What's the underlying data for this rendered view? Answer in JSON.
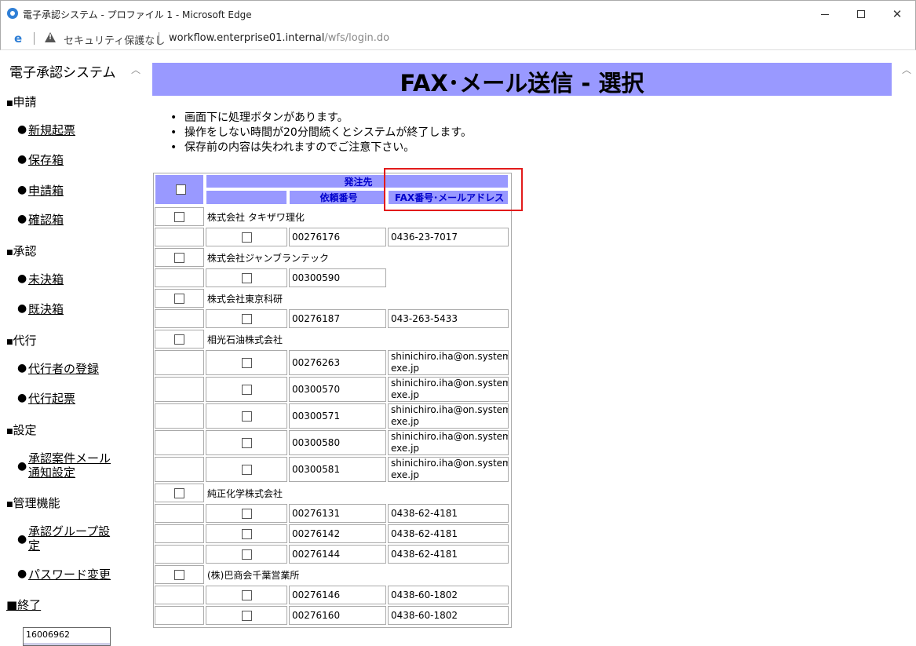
{
  "window": {
    "title": "電子承認システム - プロファイル 1 - Microsoft Edge"
  },
  "address": {
    "security_text": "セキュリティ保護なし",
    "url_host": "workflow.enterprise01.internal",
    "url_path": "/wfs/login.do"
  },
  "sidebar": {
    "title": "電子承認システム",
    "sections": {
      "apply": "申請",
      "approve": "承認",
      "proxy": "代行",
      "settings": "設定",
      "admin": "管理機能"
    },
    "items": {
      "new": "新規起票",
      "saved": "保存箱",
      "applied": "申請箱",
      "confirm": "確認箱",
      "pending": "未決箱",
      "decided": "既決箱",
      "proxy_reg": "代行者の登録",
      "proxy_issue": "代行起票",
      "notify_line1": "承認案件メール",
      "notify_line2": "通知設定",
      "group_line1": "承認グループ設",
      "group_line2": "定",
      "password": "パスワード変更"
    },
    "end_label": "■終了",
    "user_id": "16006962"
  },
  "page": {
    "heading": "FAX･メール送信 - 選択",
    "notes": [
      "画面下に処理ボタンがあります。",
      "操作をしない時間が20分間続くとシステムが終了します。",
      "保存前の内容は失われますのでご注意下さい。"
    ]
  },
  "table": {
    "header_group": "発注先",
    "col_request": "依頼番号",
    "col_fax": "FAX番号･メールアドレス",
    "companies": [
      {
        "name": "株式会社 タキザワ理化",
        "rows": [
          {
            "req": "00276176",
            "fax": "0436-23-7017"
          }
        ]
      },
      {
        "name": "株式会社ジャンブランテック",
        "rows": [
          {
            "req": "00300590",
            "fax": ""
          }
        ]
      },
      {
        "name": "株式会社東京科研",
        "rows": [
          {
            "req": "00276187",
            "fax": "043-263-5433"
          }
        ]
      },
      {
        "name": "相光石油株式会社",
        "rows": [
          {
            "req": "00276263",
            "fax_1": "shinichiro.iha@on.system-",
            "fax_2": "exe.jp"
          },
          {
            "req": "00300570",
            "fax_1": "shinichiro.iha@on.system-",
            "fax_2": "exe.jp"
          },
          {
            "req": "00300571",
            "fax_1": "shinichiro.iha@on.system-",
            "fax_2": "exe.jp"
          },
          {
            "req": "00300580",
            "fax_1": "shinichiro.iha@on.system-",
            "fax_2": "exe.jp"
          },
          {
            "req": "00300581",
            "fax_1": "shinichiro.iha@on.system-",
            "fax_2": "exe.jp"
          }
        ]
      },
      {
        "name": "純正化学株式会社",
        "rows": [
          {
            "req": "00276131",
            "fax": "0438-62-4181"
          },
          {
            "req": "00276142",
            "fax": "0438-62-4181"
          },
          {
            "req": "00276144",
            "fax": "0438-62-4181"
          }
        ]
      },
      {
        "name": "(株)巴商会千葉営業所",
        "rows": [
          {
            "req": "00276146",
            "fax": "0438-60-1802"
          },
          {
            "req": "00276160",
            "fax": "0438-60-1802"
          }
        ]
      }
    ]
  }
}
